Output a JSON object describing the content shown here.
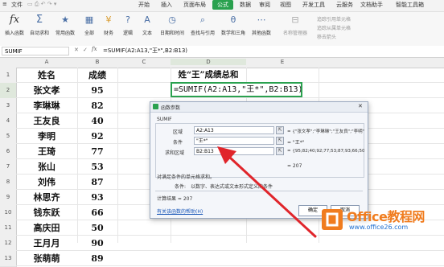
{
  "menubar": {
    "file": "文件",
    "tabs": [
      "开始",
      "插入",
      "页面布局",
      "公式",
      "数据",
      "审阅",
      "视图",
      "开发工具",
      "云服务",
      "文档助手",
      "智能工具箱"
    ],
    "active_tab": "公式"
  },
  "ribbon": {
    "buttons": [
      "插入函数",
      "自动求和",
      "常用函数",
      "全部",
      "财务",
      "逻辑",
      "文本",
      "日期和时间",
      "查找与引用",
      "数学和三角",
      "其他函数",
      "名称管理器"
    ],
    "fx_symbol": "fx",
    "right_items": [
      "追踪引用单元格",
      "追踪从属单元格",
      "移去箭头"
    ]
  },
  "formula_bar": {
    "name_box": "SUMIF",
    "formula": "=SUMIF(A2:A13,\"王*\",B2:B13)"
  },
  "columns": [
    "A",
    "B",
    "C",
    "D",
    "E"
  ],
  "rows": [
    {
      "num": "1",
      "a": "姓名",
      "b": "成绩"
    },
    {
      "num": "2",
      "a": "张文孝",
      "b": "95"
    },
    {
      "num": "3",
      "a": "李琳琳",
      "b": "82"
    },
    {
      "num": "4",
      "a": "王友良",
      "b": "40"
    },
    {
      "num": "5",
      "a": "李明",
      "b": "92"
    },
    {
      "num": "6",
      "a": "王琦",
      "b": "77"
    },
    {
      "num": "7",
      "a": "张山",
      "b": "53"
    },
    {
      "num": "8",
      "a": "刘伟",
      "b": "87"
    },
    {
      "num": "9",
      "a": "林思齐",
      "b": "93"
    },
    {
      "num": "10",
      "a": "钱东跃",
      "b": "66"
    },
    {
      "num": "11",
      "a": "高庆田",
      "b": "50"
    },
    {
      "num": "12",
      "a": "王月月",
      "b": "90"
    },
    {
      "num": "13",
      "a": "张萌萌",
      "b": "89"
    }
  ],
  "d1_title": "姓“王”成绩总和",
  "d2_formula": "=SUMIF(A2:A13,\"王*\",B2:B13)",
  "dialog": {
    "title": "函数参数",
    "function_name": "SUMIF",
    "range_label": "区域",
    "range_value": "A2:A13",
    "range_result": "= {\"张文孝\";\"李琳琳\";\"王友良\";\"李明\";\"王",
    "criteria_label": "条件",
    "criteria_value": "\"王*\"",
    "criteria_result": "= \"王*\"",
    "sum_label": "求和区域",
    "sum_value": "B2:B13",
    "sum_result": "= {95;82;40;92;77;53;87;93;66;50;90;89}",
    "total_result": "= 207",
    "description": "对满足条件的单元格求和。",
    "criteria_help_label": "条件:",
    "criteria_help_text": "以数字、表达式或文本形式定义的条件",
    "calc_result": "计算结果 = 207",
    "help_link": "有关该函数的帮助(H)",
    "ok": "确定",
    "cancel": "取消"
  },
  "watermark": {
    "text": "Office教程网",
    "url": "www.office26.com",
    "colors": {
      "orange": "#f07c1e",
      "blue": "#1e6fd0"
    }
  },
  "colors": {
    "accent": "#2aa14f",
    "arrow": "#e0252b",
    "select": "#2aa14f"
  }
}
